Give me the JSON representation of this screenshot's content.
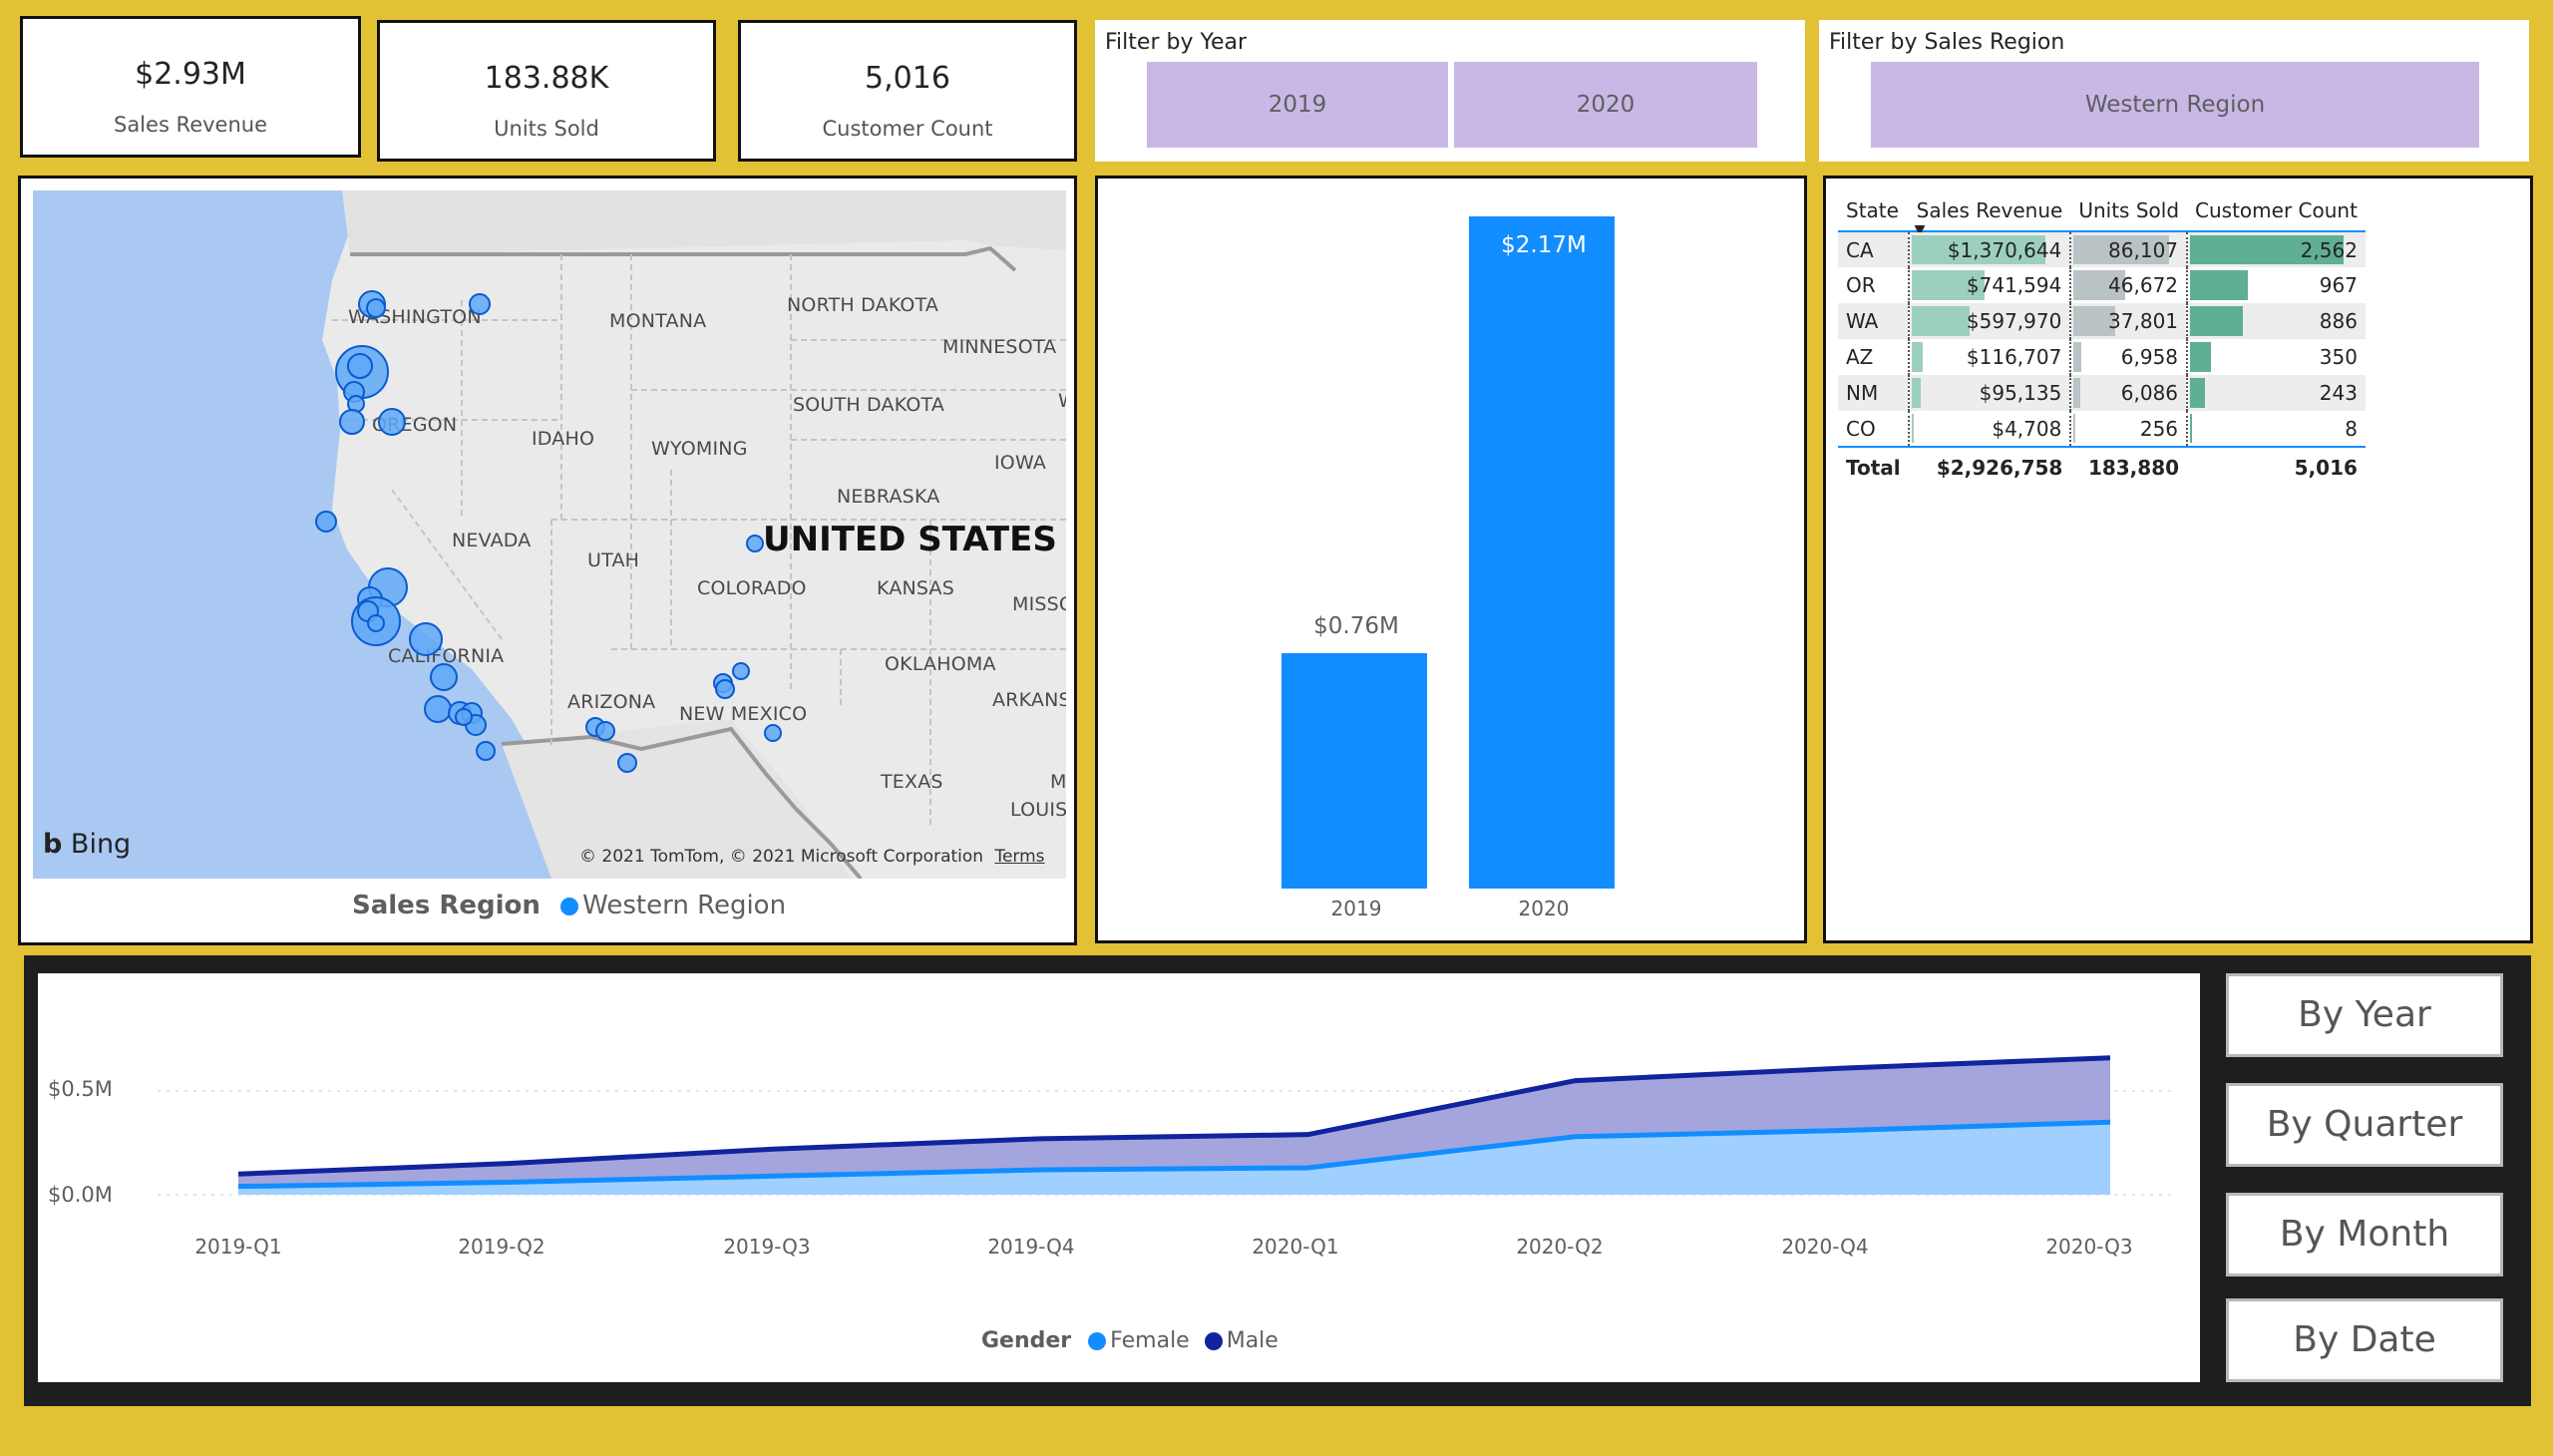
{
  "kpis": [
    {
      "value": "$2.93M",
      "label": "Sales Revenue"
    },
    {
      "value": "183.88K",
      "label": "Units Sold"
    },
    {
      "value": "5,016",
      "label": "Customer Count"
    }
  ],
  "year_slicer": {
    "title": "Filter by Year",
    "options": [
      "2019",
      "2020"
    ]
  },
  "region_slicer": {
    "title": "Filter by Sales Region",
    "options": [
      "Western Region"
    ]
  },
  "map": {
    "country_label": "UNITED STATES",
    "state_labels": [
      "WASHINGTON",
      "MONTANA",
      "NORTH DAKOTA",
      "MINNESOTA",
      "SOUTH DAKOTA",
      "OREGON",
      "IDAHO",
      "WYOMING",
      "IOWA",
      "NEBRASKA",
      "NEVADA",
      "UTAH",
      "COLORADO",
      "KANSAS",
      "MISSO",
      "CALIFORNIA",
      "OKLAHOMA",
      "ARIZONA",
      "NEW MEXICO",
      "ARKANSA",
      "TEXAS",
      "M",
      "LOUISI",
      "W"
    ],
    "provider": "Bing",
    "copyright": "© 2021 TomTom, © 2021 Microsoft Corporation",
    "terms": "Terms",
    "legend_title": "Sales Region",
    "legend_items": [
      {
        "name": "Western Region",
        "color": "#118dff"
      }
    ]
  },
  "bar_chart": {
    "categories": [
      "2019",
      "2020"
    ],
    "values": [
      0.76,
      2.17
    ],
    "labels": [
      "$0.76M",
      "$2.17M"
    ],
    "color": "#118dff"
  },
  "matrix": {
    "columns": [
      "State",
      "Sales Revenue",
      "Units Sold",
      "Customer Count"
    ],
    "rows": [
      {
        "state": "CA",
        "revenue": "$1,370,644",
        "units": "86,107",
        "customers": "2,562",
        "rev_n": 1370644,
        "units_n": 86107,
        "cust_n": 2562
      },
      {
        "state": "OR",
        "revenue": "$741,594",
        "units": "46,672",
        "customers": "967",
        "rev_n": 741594,
        "units_n": 46672,
        "cust_n": 967
      },
      {
        "state": "WA",
        "revenue": "$597,970",
        "units": "37,801",
        "customers": "886",
        "rev_n": 597970,
        "units_n": 37801,
        "cust_n": 886
      },
      {
        "state": "AZ",
        "revenue": "$116,707",
        "units": "6,958",
        "customers": "350",
        "rev_n": 116707,
        "units_n": 6958,
        "cust_n": 350
      },
      {
        "state": "NM",
        "revenue": "$95,135",
        "units": "6,086",
        "customers": "243",
        "rev_n": 95135,
        "units_n": 6086,
        "cust_n": 243
      },
      {
        "state": "CO",
        "revenue": "$4,708",
        "units": "256",
        "customers": "8",
        "rev_n": 4708,
        "units_n": 256,
        "cust_n": 8
      }
    ],
    "total": {
      "label": "Total",
      "revenue": "$2,926,758",
      "units": "183,880",
      "customers": "5,016"
    },
    "colors": {
      "revenue_bar": "#9dcfbf",
      "units_bar": "#b9c3c6",
      "customers_bar": "#5faf92"
    }
  },
  "chart_data": [
    {
      "type": "bar",
      "categories": [
        "2019",
        "2020"
      ],
      "values": [
        0.76,
        2.17
      ],
      "data_labels": [
        "$0.76M",
        "$2.17M"
      ],
      "title": "",
      "xlabel": "",
      "ylabel": ""
    },
    {
      "type": "area",
      "x": [
        "2019-Q1",
        "2019-Q2",
        "2019-Q3",
        "2019-Q4",
        "2020-Q1",
        "2020-Q2",
        "2020-Q3",
        "2020-Q4",
        "2020-Q3"
      ],
      "stacked": true,
      "series": [
        {
          "name": "Female",
          "color": "#118dff",
          "values": [
            0.04,
            0.06,
            0.09,
            0.12,
            0.13,
            0.28,
            0.31,
            0.35
          ]
        },
        {
          "name": "Male",
          "color": "#12239e",
          "values": [
            0.06,
            0.09,
            0.13,
            0.15,
            0.16,
            0.27,
            0.3,
            0.31
          ]
        }
      ],
      "x_ticks": [
        "2019-Q1",
        "2019-Q2",
        "2019-Q3",
        "2019-Q4",
        "2020-Q1",
        "2020-Q2",
        "2020-Q4",
        "2020-Q3"
      ],
      "y_ticks": [
        "$0.0M",
        "$0.5M"
      ],
      "ylim": [
        0,
        0.75
      ],
      "legend_title": "Gender",
      "legend_position": "bottom-center",
      "grid": true
    }
  ],
  "area_legend": {
    "title": "Gender",
    "items": [
      {
        "name": "Female",
        "color": "#118dff"
      },
      {
        "name": "Male",
        "color": "#12239e"
      }
    ]
  },
  "nav_buttons": [
    "By Year",
    "By Quarter",
    "By Month",
    "By Date"
  ]
}
